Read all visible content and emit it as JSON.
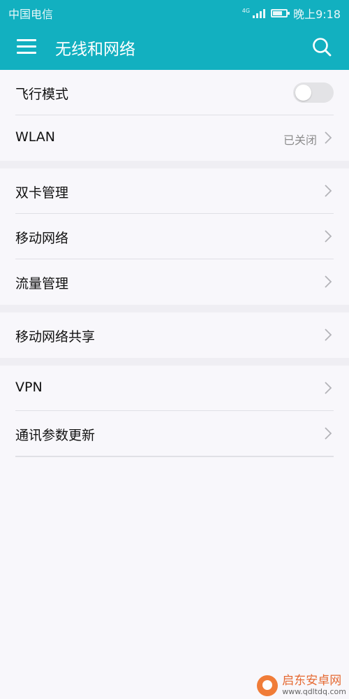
{
  "status_bar": {
    "carrier": "中国电信",
    "network": "4G",
    "time": "晚上9:18",
    "battery_level_percent": 70
  },
  "app_bar": {
    "title": "无线和网络",
    "menu_icon": "menu-icon",
    "search_icon": "search-icon"
  },
  "groups": [
    {
      "items": [
        {
          "label": "飞行模式",
          "control": "toggle",
          "toggle_on": false
        },
        {
          "label": "WLAN",
          "value": "已关闭",
          "control": "chevron"
        }
      ]
    },
    {
      "items": [
        {
          "label": "双卡管理",
          "control": "chevron"
        },
        {
          "label": "移动网络",
          "control": "chevron"
        },
        {
          "label": "流量管理",
          "control": "chevron"
        }
      ]
    },
    {
      "items": [
        {
          "label": "移动网络共享",
          "control": "chevron"
        }
      ]
    },
    {
      "items": [
        {
          "label": "VPN",
          "control": "chevron"
        },
        {
          "label": "通讯参数更新",
          "control": "chevron"
        }
      ]
    }
  ],
  "watermark": {
    "name": "启东安卓网",
    "url": "www.qdltdq.com"
  },
  "colors": {
    "accent": "#12b0c0",
    "background": "#f8f7fb",
    "divider": "#e0e0e5",
    "toggle_off": "#e3e3e6"
  }
}
